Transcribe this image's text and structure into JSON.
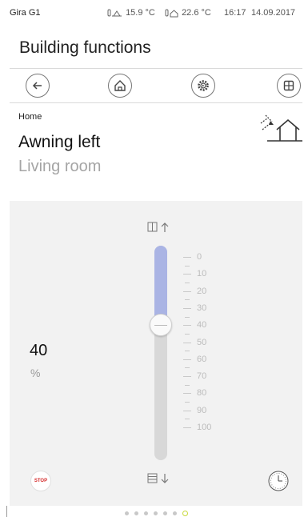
{
  "status_bar": {
    "brand": "Gira G1",
    "outdoor_temp": "15.9 °C",
    "indoor_temp": "22.6 °C",
    "time": "16:17",
    "date": "14.09.2017"
  },
  "header": {
    "title": "Building functions"
  },
  "nav": {
    "buttons": [
      {
        "icon": "back-arrow-icon"
      },
      {
        "icon": "home-icon"
      },
      {
        "icon": "settings-icon"
      },
      {
        "icon": "grid-icon"
      }
    ]
  },
  "function": {
    "breadcrumb": "Home",
    "name": "Awning left",
    "room": "Living room",
    "type_icon": "awning-house-icon"
  },
  "position": {
    "value": "40",
    "unit": "%",
    "fraction": 0.4
  },
  "scale": {
    "labels": [
      "0",
      "10",
      "20",
      "30",
      "40",
      "50",
      "60",
      "70",
      "80",
      "90",
      "100"
    ]
  },
  "controls": {
    "stop_label": "STOP",
    "up_icon": "awning-up-icon",
    "down_icon": "awning-down-icon",
    "timer_icon": "clock-icon"
  },
  "pagination": {
    "count": 7,
    "active": 6
  },
  "colors": {
    "slider_fill": "#aab4e4",
    "slider_track": "#d8d8d8",
    "stop_text": "#d52b2b",
    "active_dot": "#c8d93a"
  }
}
